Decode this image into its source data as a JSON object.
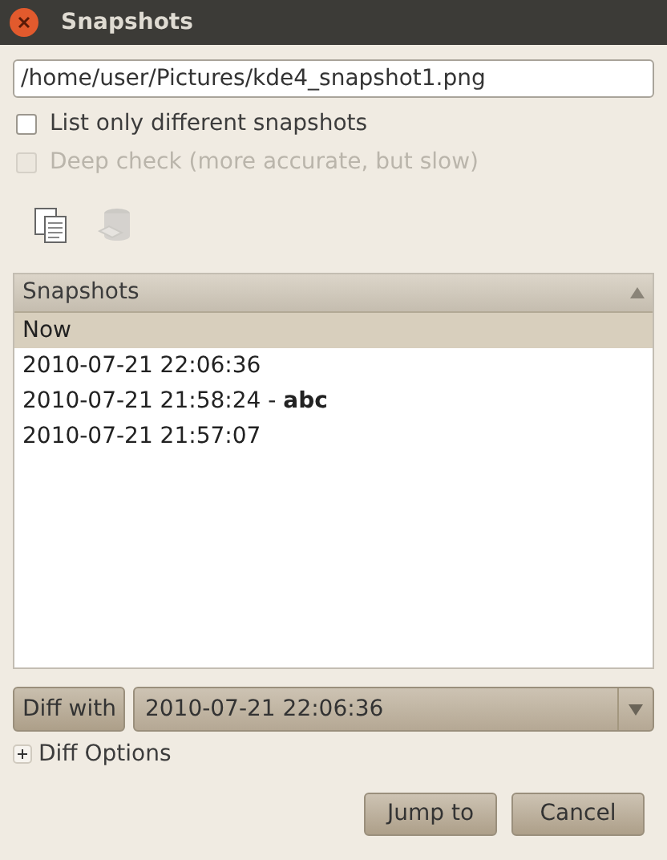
{
  "window": {
    "title": "Snapshots"
  },
  "path_field": {
    "value": "/home/user/Pictures/kde4_snapshot1.png"
  },
  "options": [
    {
      "label": "List only different snapshots",
      "checked": false,
      "disabled": false
    },
    {
      "label": "Deep check (more accurate, but slow)",
      "checked": false,
      "disabled": true
    }
  ],
  "toolbar": [
    {
      "kind": "copy",
      "disabled": false
    },
    {
      "kind": "delete",
      "disabled": true
    }
  ],
  "list": {
    "header": "Snapshots",
    "rows": [
      {
        "text": "Now",
        "selected": true
      },
      {
        "text": "2010-07-21 22:06:36",
        "selected": false
      },
      {
        "text": "2010-07-21 21:58:24 - **abc**",
        "selected": false
      },
      {
        "text": "2010-07-21 21:57:07",
        "selected": false
      }
    ]
  },
  "diff": {
    "button": "Diff with",
    "value": "2010-07-21 22:06:36"
  },
  "diff_options": {
    "label": "Diff Options",
    "expanded": false
  },
  "buttons": [
    "Jump to",
    "Cancel"
  ]
}
